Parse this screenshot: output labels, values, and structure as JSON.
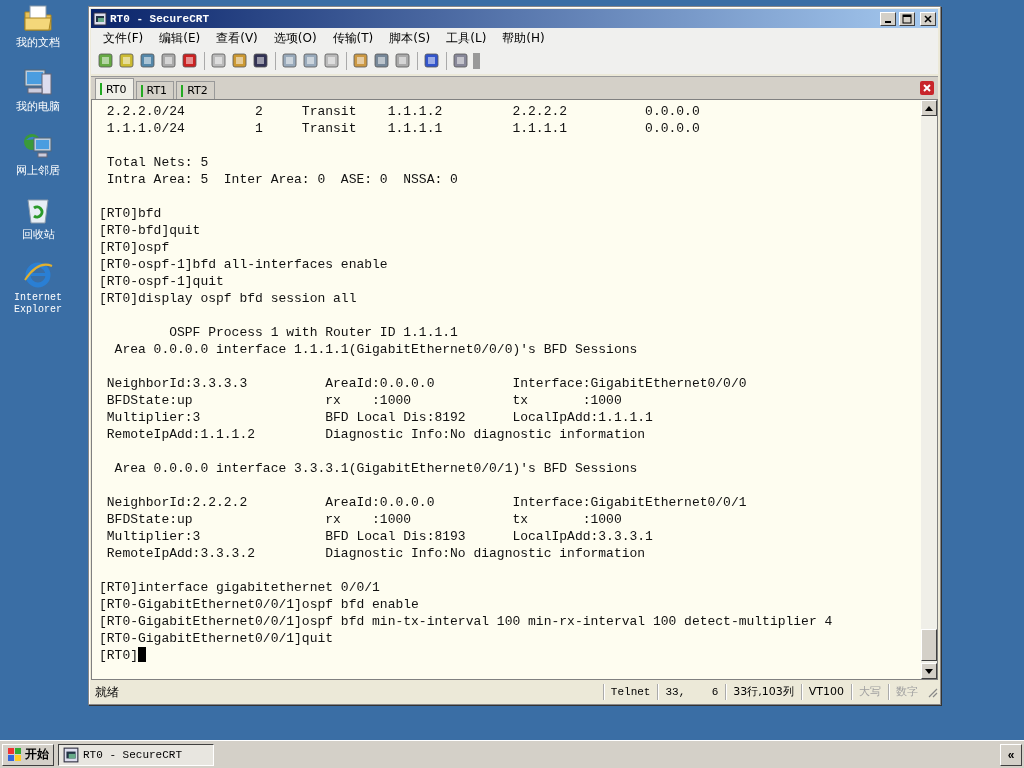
{
  "desktop_icons": [
    {
      "label": "我的文档",
      "kind": "folder"
    },
    {
      "label": "我的电脑",
      "kind": "computer"
    },
    {
      "label": "网上邻居",
      "kind": "network"
    },
    {
      "label": "回收站",
      "kind": "recycle"
    },
    {
      "label": "Internet Explorer",
      "kind": "browser"
    }
  ],
  "window": {
    "title": "RT0 - SecureCRT"
  },
  "menu": [
    "文件(F)",
    "编辑(E)",
    "查看(V)",
    "选项(O)",
    "传输(T)",
    "脚本(S)",
    "工具(L)",
    "帮助(H)"
  ],
  "tabs": [
    {
      "label": "RT0",
      "selected": true
    },
    {
      "label": "RT1",
      "selected": false
    },
    {
      "label": "RT2",
      "selected": false
    }
  ],
  "terminal_blocks": [
    {
      "lines": [
        " 2.2.2.0/24         2     Transit    1.1.1.2         2.2.2.2          0.0.0.0",
        " 1.1.1.0/24         1     Transit    1.1.1.1         1.1.1.1          0.0.0.0"
      ]
    },
    {
      "lines": [
        " Total Nets: 5",
        " Intra Area: 5  Inter Area: 0  ASE: 0  NSSA: 0"
      ]
    },
    {
      "lines": [
        "[RT0]bfd",
        "[RT0-bfd]quit",
        "[RT0]ospf",
        "[RT0-ospf-1]bfd all-interfaces enable",
        "[RT0-ospf-1]quit",
        "[RT0]display ospf bfd session all"
      ]
    },
    {
      "lines": [
        "         OSPF Process 1 with Router ID 1.1.1.1",
        "  Area 0.0.0.0 interface 1.1.1.1(GigabitEthernet0/0/0)'s BFD Sessions"
      ]
    },
    {
      "lines": [
        " NeighborId:3.3.3.3          AreaId:0.0.0.0          Interface:GigabitEthernet0/0/0",
        " BFDState:up                 rx    :1000             tx       :1000",
        " Multiplier:3                BFD Local Dis:8192      LocalIpAdd:1.1.1.1",
        " RemoteIpAdd:1.1.1.2         Diagnostic Info:No diagnostic information"
      ]
    },
    {
      "lines": [
        "  Area 0.0.0.0 interface 3.3.3.1(GigabitEthernet0/0/1)'s BFD Sessions"
      ]
    },
    {
      "lines": [
        " NeighborId:2.2.2.2          AreaId:0.0.0.0          Interface:GigabitEthernet0/0/1",
        " BFDState:up                 rx    :1000             tx       :1000",
        " Multiplier:3                BFD Local Dis:8193      LocalIpAdd:3.3.3.1",
        " RemoteIpAdd:3.3.3.2         Diagnostic Info:No diagnostic information"
      ]
    },
    {
      "lines": [
        "[RT0]interface gigabitethernet 0/0/1",
        "[RT0-GigabitEthernet0/0/1]ospf bfd enable",
        "[RT0-GigabitEthernet0/0/1]ospf bfd min-tx-interval 100 min-rx-interval 100 detect-multiplier 4",
        "[RT0-GigabitEthernet0/0/1]quit",
        "[RT0]"
      ]
    }
  ],
  "status_bar": {
    "message": "就绪",
    "fields": [
      {
        "text": "Telnet",
        "disabled": false
      },
      {
        "text": "33,    6",
        "disabled": false
      },
      {
        "text": "33行,103列",
        "disabled": false
      },
      {
        "text": "VT100",
        "disabled": false
      },
      {
        "text": "大写",
        "disabled": true
      },
      {
        "text": "数字",
        "disabled": true
      }
    ]
  },
  "taskbar": {
    "start": "开始",
    "tasks": [
      "RT0 - SecureCRT"
    ],
    "tray_button": "«"
  }
}
